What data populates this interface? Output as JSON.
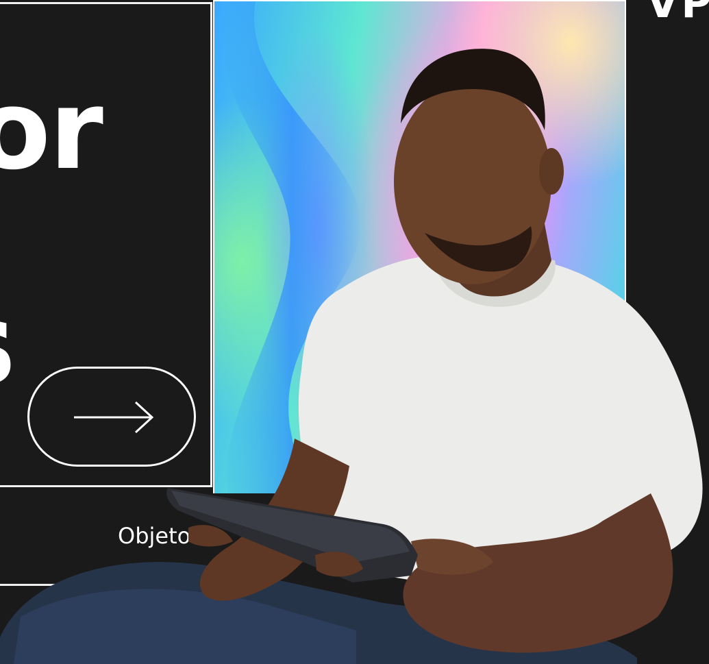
{
  "hero": {
    "headline_line_1": "or",
    "headline_line_2": "s",
    "corner_text": "VPN"
  },
  "cta": {
    "icon": "arrow-right-icon"
  },
  "nav": {
    "category_label": "Objetos"
  },
  "colors": {
    "background": "#1a1a1a",
    "foreground": "#ffffff",
    "gradient": [
      "#3aa8ff",
      "#5ee6d2",
      "#ff9fe6",
      "#b6a0ff",
      "#35e3e0"
    ]
  },
  "photo": {
    "subject": "man in white t-shirt looking at tablet"
  }
}
